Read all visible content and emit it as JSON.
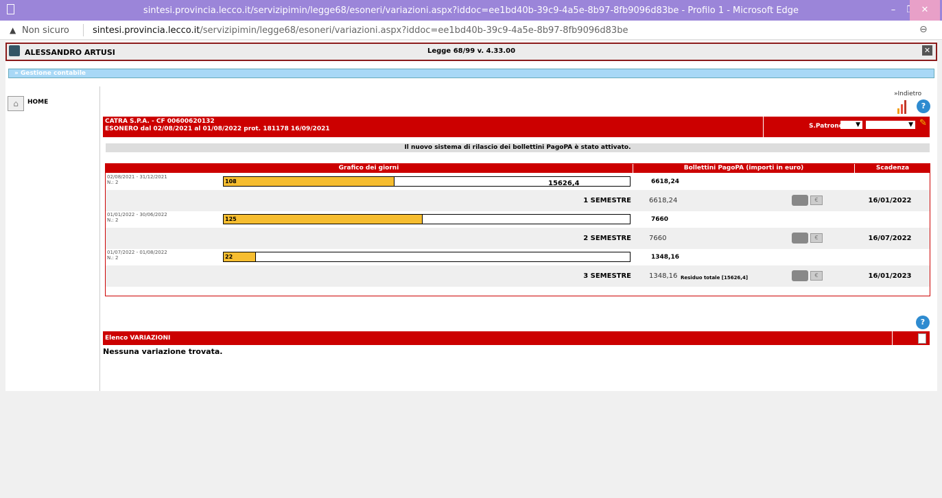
{
  "window": {
    "title": "sintesi.provincia.lecco.it/servizipimin/legge68/esoneri/variazioni.aspx?iddoc=ee1bd40b-39c9-4a5e-8b97-8fb9096d83be - Profilo 1 - Microsoft Edge",
    "minimize": "–",
    "maximize": "❐",
    "close": "✕"
  },
  "address": {
    "warning_icon": "▲",
    "not_secure": "Non sicuro",
    "host": "sintesi.provincia.lecco.it",
    "path": "/servizipimin/legge68/esoneri/variazioni.aspx?iddoc=ee1bd40b-39c9-4a5e-8b97-8fb9096d83be",
    "zoom_icon": "⊖"
  },
  "header": {
    "user": "ALESSANDRO ARTUSI",
    "version": "Legge 68/99 v. 4.33.00",
    "close": "✕"
  },
  "menu": {
    "label": "» Gestione contabile"
  },
  "sidebar": {
    "home": "HOME"
  },
  "toolbar": {
    "back": "»Indietro",
    "help": "?"
  },
  "company": {
    "line1": "CATRA S.P.A. - CF 00600620132",
    "line2": "ESONERO dal 02/08/2021 al  01/08/2022  prot. 181178  16/09/2021",
    "spatrono": "S.Patrono",
    "select1": "▼",
    "select2": "▼",
    "pencil": "✎"
  },
  "notice": "Il nuovo sistema di rilascio dei bollettini PagoPA è stato attivato.",
  "table": {
    "headers": [
      "Grafico dei giorni",
      "Bollettini PagoPA (importi in euro)",
      "Scadenza"
    ],
    "periods": [
      {
        "dates": "02/08/2021 - 31/12/2021",
        "n": "N.: 2",
        "days": "108",
        "fill": 0.42,
        "amount": "6618,24"
      },
      {
        "dates": "01/01/2022 - 30/06/2022",
        "n": "N.: 2",
        "days": "125",
        "fill": 0.49,
        "amount": "7660"
      },
      {
        "dates": "01/07/2022 - 01/08/2022",
        "n": "N.: 2",
        "days": "22",
        "fill": 0.08,
        "amount": "1348,16"
      }
    ],
    "semesters": [
      {
        "label": "1 SEMESTRE",
        "amount": "6618,24",
        "residuo": "",
        "date": "16/01/2022"
      },
      {
        "label": "2 SEMESTRE",
        "amount": "7660",
        "residuo": "",
        "date": "16/07/2022"
      },
      {
        "label": "3 SEMESTRE",
        "amount": "1348,16",
        "residuo": "Residuo totale [15626,4]",
        "date": "16/01/2023"
      }
    ],
    "total": "15626,4"
  },
  "variazioni": {
    "title": "Elenco VARIAZIONI",
    "empty": "Nessuna variazione trovata."
  },
  "icons": {
    "doc_symbol": "€"
  }
}
